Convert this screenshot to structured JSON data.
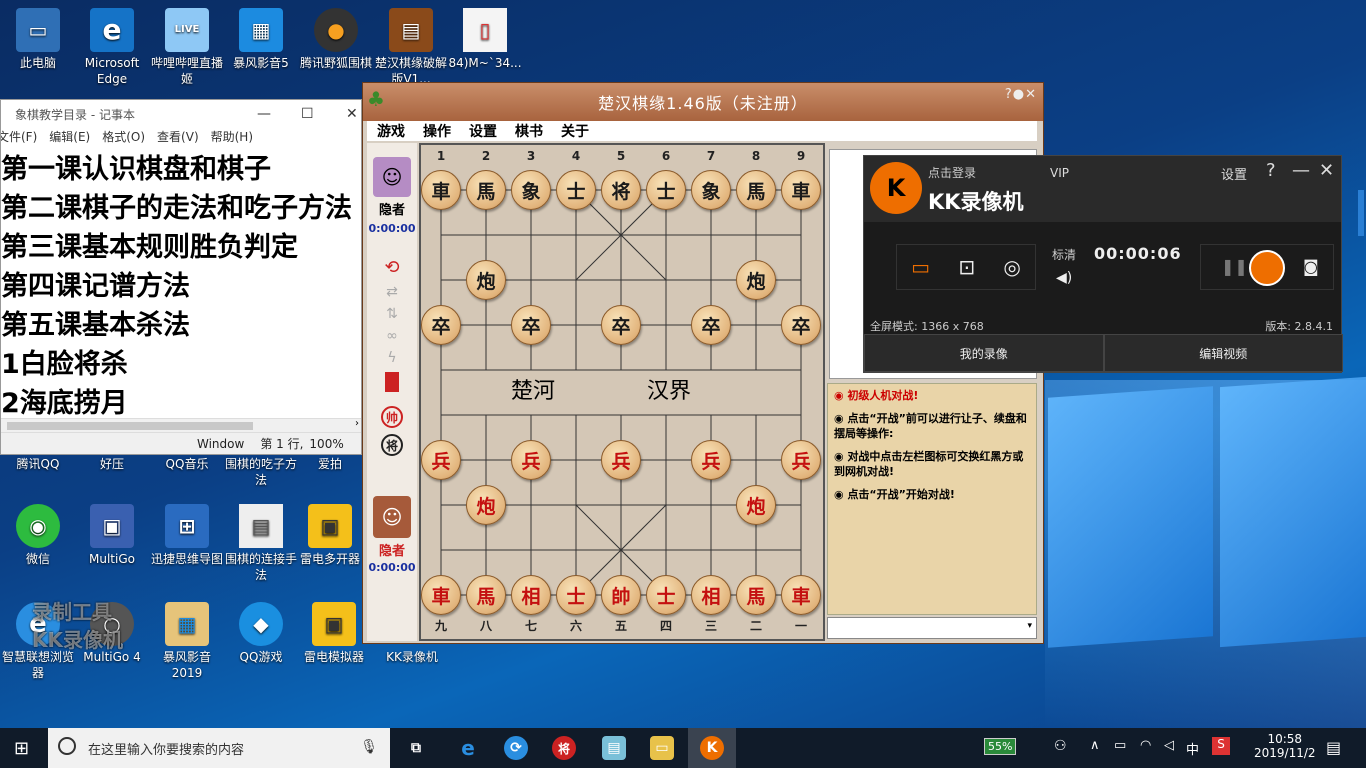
{
  "desktop": {
    "icons": [
      {
        "label": "此电脑",
        "glyph": "▭",
        "color": "#2f6fb5"
      },
      {
        "label": "Microsoft Edge",
        "glyph": "e",
        "color": "#1573c7"
      },
      {
        "label": "哔哩哔哩直播姬",
        "glyph": "LIVE",
        "color": "#5aa7e8"
      },
      {
        "label": "暴风影音5",
        "glyph": "▦",
        "color": "#1c8be0"
      },
      {
        "label": "腾讯野狐围棋",
        "glyph": "●",
        "color": "#333"
      },
      {
        "label": "楚汉棋缘破解版V1...",
        "glyph": "▤",
        "color": "#8a4a1a"
      },
      {
        "label": "84)M~`34...",
        "glyph": "▯",
        "color": "#f4f4f4"
      },
      {
        "label": "腾讯QQ",
        "glyph": "",
        "color": ""
      },
      {
        "label": "好压",
        "glyph": "",
        "color": ""
      },
      {
        "label": "QQ音乐",
        "glyph": "",
        "color": ""
      },
      {
        "label": "围棋的吃子方法",
        "glyph": "",
        "color": ""
      },
      {
        "label": "爱拍",
        "glyph": "",
        "color": ""
      },
      {
        "label": "微信",
        "glyph": "◉",
        "color": "#2dbb3f"
      },
      {
        "label": "MultiGo",
        "glyph": "▣",
        "color": "#3a60b0"
      },
      {
        "label": "迅捷思维导图",
        "glyph": "⊞",
        "color": "#2a6bc0"
      },
      {
        "label": "围棋的连接手法",
        "glyph": "▤",
        "color": "#eeeeee"
      },
      {
        "label": "雷电多开器",
        "glyph": "▣",
        "color": "#f4c01a"
      },
      {
        "label": "智慧联想浏览器",
        "glyph": "e",
        "color": "#2a8ee0"
      },
      {
        "label": "MultiGo 4",
        "glyph": "○",
        "color": "#555"
      },
      {
        "label": "暴风影音2019",
        "glyph": "▦",
        "color": "#1c8be0"
      },
      {
        "label": "QQ游戏",
        "glyph": "◆",
        "color": "#1a8fe0"
      },
      {
        "label": "雷电模拟器",
        "glyph": "▣",
        "color": "#f4c01a"
      },
      {
        "label": "KK录像机",
        "glyph": "",
        "color": ""
      }
    ],
    "watermark": "录制工具\nKK录像机"
  },
  "notepad": {
    "title": "象棋教学目录 - 记事本",
    "menu": [
      "文件(F)",
      "编辑(E)",
      "格式(O)",
      "查看(V)",
      "帮助(H)"
    ],
    "lines": [
      "第一课认识棋盘和棋子",
      "第二课棋子的走法和吃子方法",
      "第三课基本规则胜负判定",
      "第四课记谱方法",
      "第五课基本杀法",
      "1白脸将杀",
      "2海底捞月"
    ],
    "status": {
      "encoding": "Window",
      "position": "第 1 行,",
      "zoom": "100%"
    }
  },
  "xiangqi": {
    "title": "楚汉棋缘1.46版（未注册）",
    "menu": [
      "游戏",
      "操作",
      "设置",
      "棋书",
      "关于"
    ],
    "top_player": {
      "name": "隐者",
      "time": "0:00:00"
    },
    "bottom_player": {
      "name": "隐者",
      "time": "0:00:00"
    },
    "top_numbers": [
      "1",
      "2",
      "3",
      "4",
      "5",
      "6",
      "7",
      "8",
      "9"
    ],
    "bottom_numbers": [
      "九",
      "八",
      "七",
      "六",
      "五",
      "四",
      "三",
      "二",
      "一"
    ],
    "river": {
      "left": "楚河",
      "right": "汉界"
    },
    "black_back": [
      "車",
      "馬",
      "象",
      "士",
      "将",
      "士",
      "象",
      "馬",
      "車"
    ],
    "black_cannons": [
      "炮",
      "炮"
    ],
    "black_pawns": [
      "卒",
      "卒",
      "卒",
      "卒",
      "卒"
    ],
    "red_pawns": [
      "兵",
      "兵",
      "兵",
      "兵",
      "兵"
    ],
    "red_cannons": [
      "炮",
      "炮"
    ],
    "red_back": [
      "車",
      "馬",
      "相",
      "士",
      "帥",
      "士",
      "相",
      "馬",
      "車"
    ],
    "side_icons": {
      "red_king": "帅",
      "black_king": "将"
    },
    "tips": [
      {
        "text": "初级人机对战!",
        "red": true
      },
      {
        "text": "点击“开战”前可以进行让子、续盘和摆局等操作:",
        "red": false
      },
      {
        "text": "对战中点击左栏图标可交换红黑方或到网机对战!",
        "red": false
      },
      {
        "text": "点击“开战”开始对战!",
        "red": false
      }
    ]
  },
  "kk": {
    "login": "点击登录",
    "vip": "VIP",
    "settings": "设置",
    "brand": "KK录像机",
    "quality": "标清",
    "timer": "00:00:06",
    "fullscreen": "全屏模式: 1366 x 768",
    "version": "版本: 2.8.4.1",
    "tabs": [
      "我的录像",
      "编辑视频"
    ],
    "accent": "#ee6e00"
  },
  "taskbar": {
    "search_placeholder": "在这里输入你要搜索的内容",
    "battery": "55%",
    "ime": "中",
    "time": "10:58",
    "date": "2019/11/2"
  }
}
